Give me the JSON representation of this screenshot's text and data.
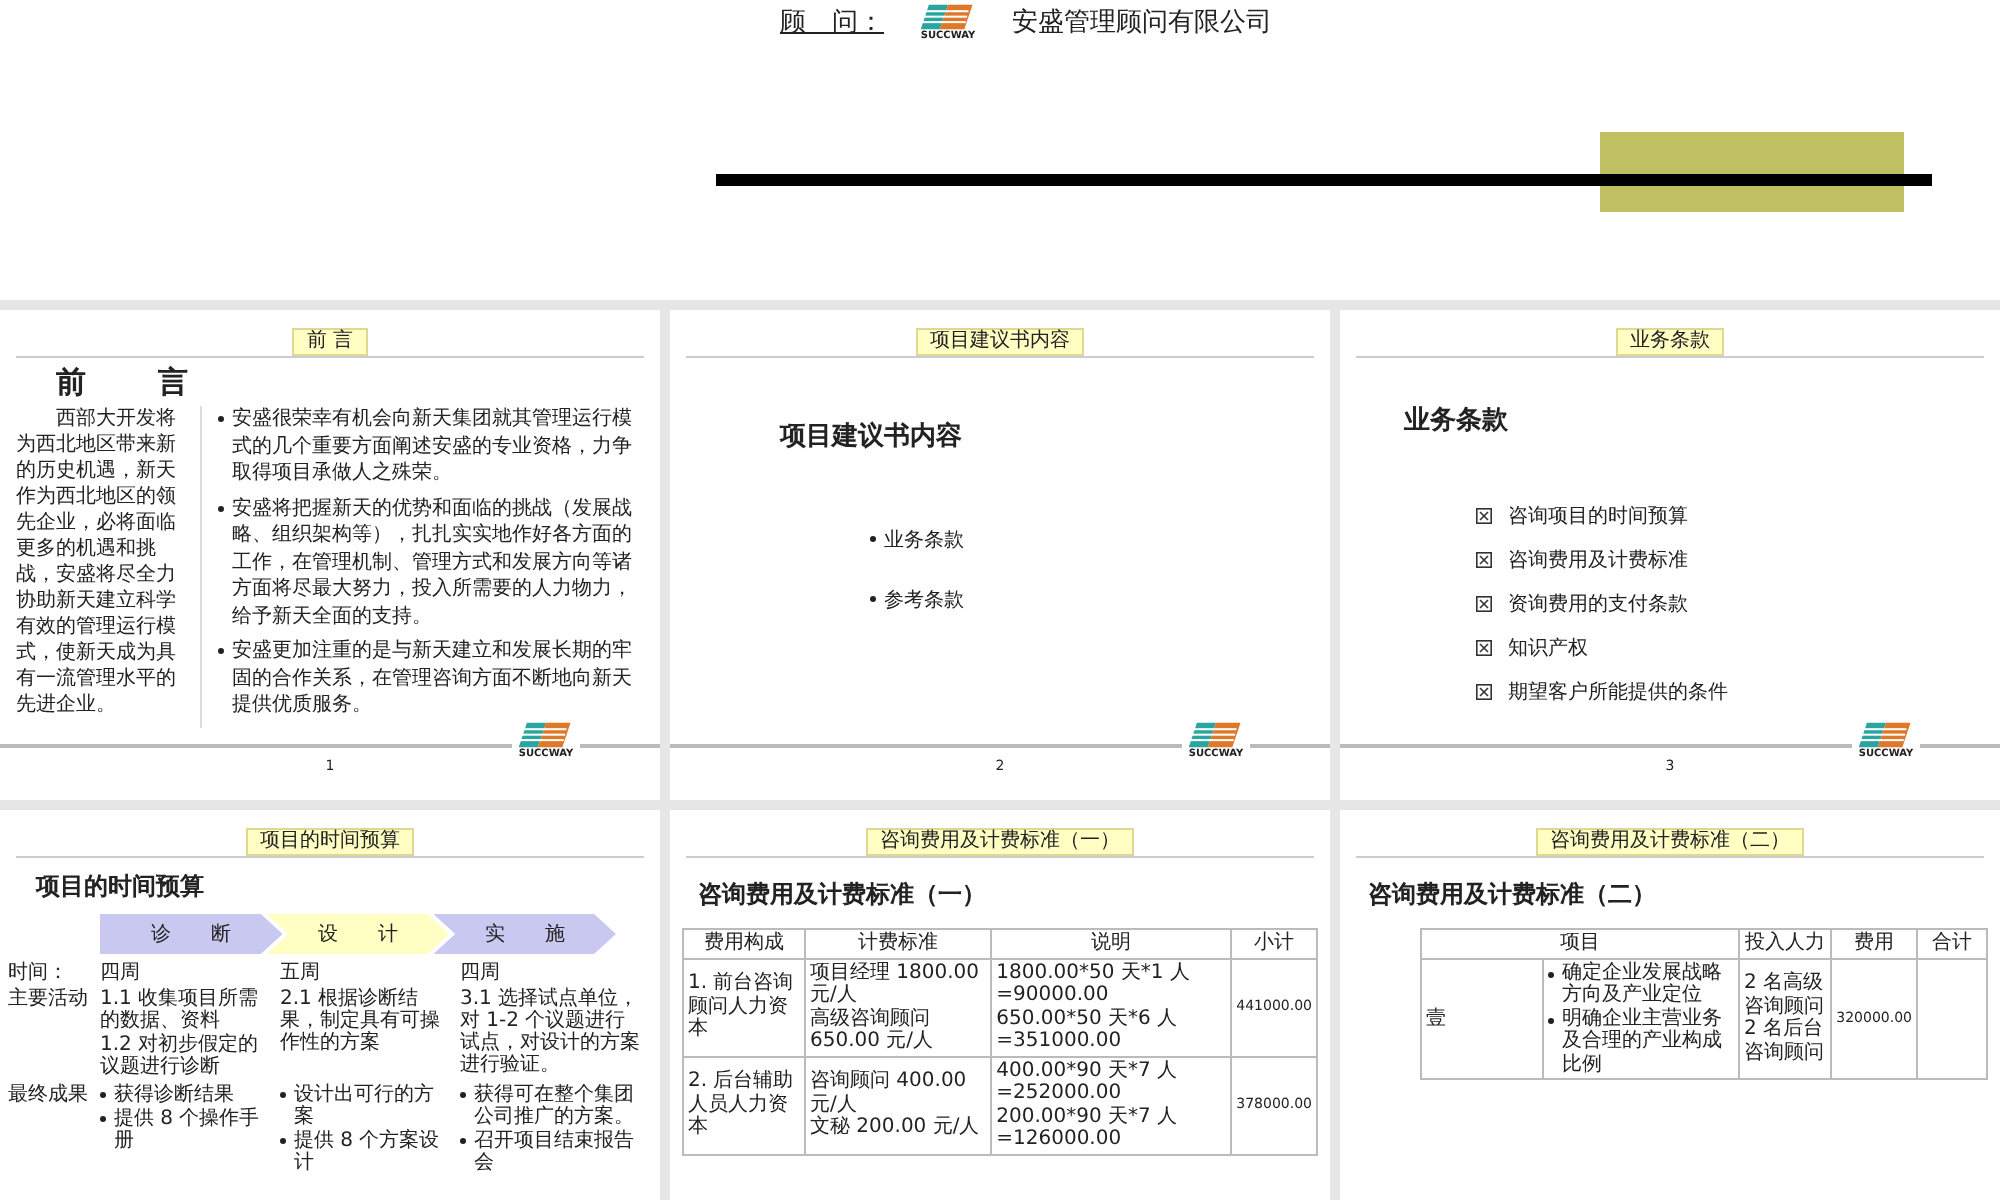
{
  "cover_fragment": {
    "consultant_label": "顾　问：",
    "logo_text": "SUCCWAY",
    "company": "安盛管理顾问有限公司"
  },
  "slides": [
    {
      "kind": "preface",
      "tab": "前 言",
      "title": "前　　言",
      "left_text": "西部大开发将为西北地区带来新的历史机遇，新天作为西北地区的领先企业，必将面临更多的机遇和挑战，安盛将尽全力协助新天建立科学有效的管理运行模式，使新天成为具有一流管理水平的先进企业。",
      "bullets": [
        "安盛很荣幸有机会向新天集团就其管理运行模式的几个重要方面阐述安盛的专业资格，力争取得项目承做人之殊荣。",
        "安盛将把握新天的优势和面临的挑战（发展战略、组织架构等），扎扎实实地作好各方面的工作，在管理机制、管理方式和发展方向等诸方面将尽最大努力，投入所需要的人力物力，给予新天全面的支持。",
        "安盛更加注重的是与新天建立和发展长期的牢固的合作关系，在管理咨询方面不断地向新天提供优质服务。"
      ],
      "page": "1",
      "logo_text": "SUCCWAY"
    },
    {
      "kind": "bullets",
      "tab": "项目建议书内容",
      "title": "项目建议书内容",
      "items": [
        "业务条款",
        "参考条款"
      ],
      "page": "2",
      "logo_text": "SUCCWAY"
    },
    {
      "kind": "checklist",
      "tab": "业务条款",
      "title": "业务条款",
      "items": [
        "咨询项目的时间预算",
        "咨询费用及计费标准",
        "资询费用的支付条款",
        "知识产权",
        "期望客户所能提供的条件"
      ],
      "page": "3",
      "logo_text": "SUCCWAY"
    },
    {
      "kind": "timeline",
      "tab": "项目的时间预算",
      "title": "项目的时间预算",
      "phases": [
        {
          "label": "诊　　断",
          "color": "#c8c8f0"
        },
        {
          "label": "设　　计",
          "color": "#ffffc4"
        },
        {
          "label": "实　　施",
          "color": "#c8c8f0"
        }
      ],
      "time_label": "时间：",
      "durations": [
        "四周",
        "五周",
        "四周"
      ],
      "activities_label": "主要活动",
      "activities": [
        [
          "1.1 收集项目所需的数据、资料",
          "1.2 对初步假定的议题进行诊断"
        ],
        [
          "2.1 根据诊断结果，制定具有可操作性的方案"
        ],
        [
          "3.1 选择试点单位，对 1-2 个议题进行试点，对设计的方案进行验证。"
        ]
      ],
      "results_label": "最终成果",
      "results": [
        [
          "获得诊断结果",
          "提供 8 个操作手册"
        ],
        [
          "设计出可行的方案",
          "提供 8 个方案设计"
        ],
        [
          "获得可在整个集团公司推广的方案。",
          "召开项目结束报告会"
        ]
      ]
    },
    {
      "kind": "fee_table",
      "tab": "咨询费用及计费标准（一）",
      "title": "咨询费用及计费标准（一）",
      "columns": [
        "费用构成",
        "计费标准",
        "说明",
        "小计"
      ],
      "rows": [
        {
          "item": "1. 前台咨询顾问人力资本",
          "rates": [
            "项目经理 1800.00 元/人",
            "高级咨询顾问 650.00 元/人"
          ],
          "notes": [
            "1800.00*50 天*1 人 =90000.00",
            "650.00*50 天*6 人 =351000.00"
          ],
          "subtotal": "441000.00"
        },
        {
          "item": "2. 后台辅助人员人力资本",
          "rates": [
            "咨询顾问 400.00 元/人",
            "文秘 200.00 元/人"
          ],
          "notes": [
            "400.00*90 天*7 人 =252000.00",
            "200.00*90 天*7 人 =126000.00"
          ],
          "subtotal": "378000.00"
        }
      ]
    },
    {
      "kind": "fee_table2",
      "tab": "咨询费用及计费标准（二）",
      "title": "咨询费用及计费标准（二）",
      "columns": [
        "项目",
        "投入人力",
        "费用",
        "合计"
      ],
      "rows": [
        {
          "label": "壹",
          "points": [
            "确定企业发展战略方向及产业定位",
            "明确企业主营业务及合理的产业构成比例"
          ],
          "staff": [
            "2 名高级咨询顾问",
            "2 名后台咨询顾问"
          ],
          "fee": "320000.00"
        }
      ]
    }
  ]
}
